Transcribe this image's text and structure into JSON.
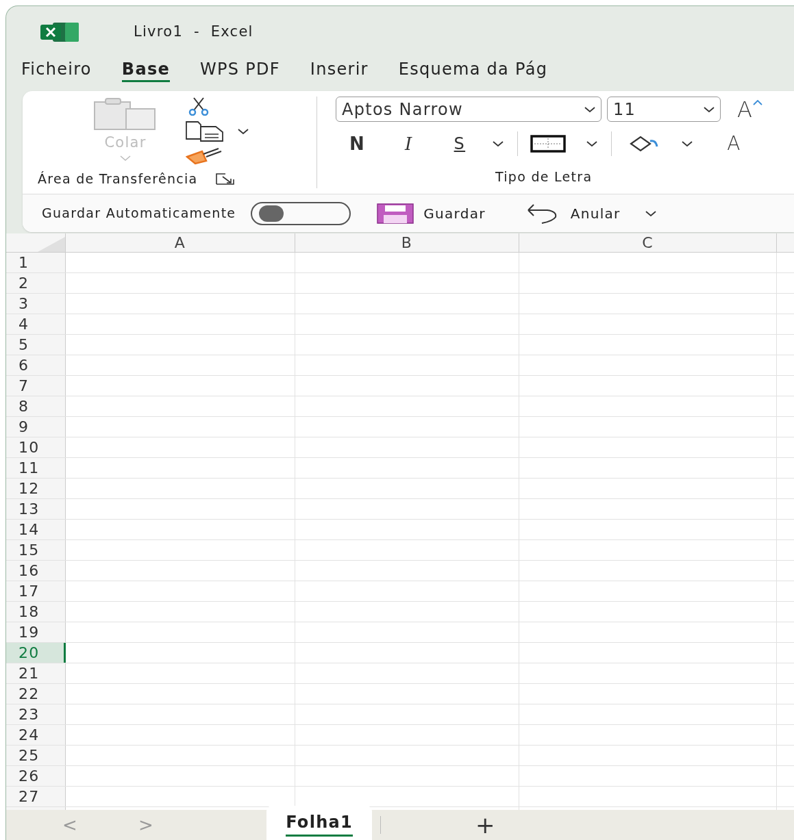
{
  "window": {
    "title": "Livro1  -  Excel"
  },
  "tabs": [
    {
      "label": "Ficheiro",
      "selected": false
    },
    {
      "label": "Base",
      "selected": true
    },
    {
      "label": "WPS PDF",
      "selected": false
    },
    {
      "label": "Inserir",
      "selected": false
    },
    {
      "label": "Esquema da Pág",
      "selected": false
    }
  ],
  "clipboard": {
    "paste_label": "Colar",
    "paste_disabled": true,
    "group_label": "Área de Transferência"
  },
  "font": {
    "name": "Aptos Narrow",
    "size": "11",
    "group_label": "Tipo de Letra",
    "bold_label": "N",
    "italic_label": "I",
    "underline_label": "S",
    "grow_label": "A",
    "color_label": "A"
  },
  "quick_access": {
    "autosave_label": "Guardar Automaticamente",
    "autosave_on": false,
    "save_label": "Guardar",
    "undo_label": "Anular"
  },
  "columns": [
    {
      "label": "A",
      "selected": false
    },
    {
      "label": "B",
      "selected": false
    },
    {
      "label": "C",
      "selected": false
    }
  ],
  "rows": [
    {
      "label": "1",
      "selected": false
    },
    {
      "label": "2",
      "selected": false
    },
    {
      "label": "3",
      "selected": false
    },
    {
      "label": "4",
      "selected": false
    },
    {
      "label": "5",
      "selected": false
    },
    {
      "label": "6",
      "selected": false
    },
    {
      "label": "7",
      "selected": false
    },
    {
      "label": "8",
      "selected": false
    },
    {
      "label": "9",
      "selected": false
    },
    {
      "label": "10",
      "selected": false
    },
    {
      "label": "11",
      "selected": false
    },
    {
      "label": "12",
      "selected": false
    },
    {
      "label": "13",
      "selected": false
    },
    {
      "label": "14",
      "selected": false
    },
    {
      "label": "15",
      "selected": false
    },
    {
      "label": "16",
      "selected": false
    },
    {
      "label": "17",
      "selected": false
    },
    {
      "label": "18",
      "selected": false
    },
    {
      "label": "19",
      "selected": false
    },
    {
      "label": "20",
      "selected": true
    },
    {
      "label": "21",
      "selected": false
    },
    {
      "label": "22",
      "selected": false
    },
    {
      "label": "23",
      "selected": false
    },
    {
      "label": "24",
      "selected": false
    },
    {
      "label": "25",
      "selected": false
    },
    {
      "label": "26",
      "selected": false
    },
    {
      "label": "27",
      "selected": false
    }
  ],
  "sheet_bar": {
    "prev": "<",
    "next": ">",
    "add": "+",
    "sheets": [
      {
        "label": "Folha1",
        "selected": true
      }
    ]
  }
}
